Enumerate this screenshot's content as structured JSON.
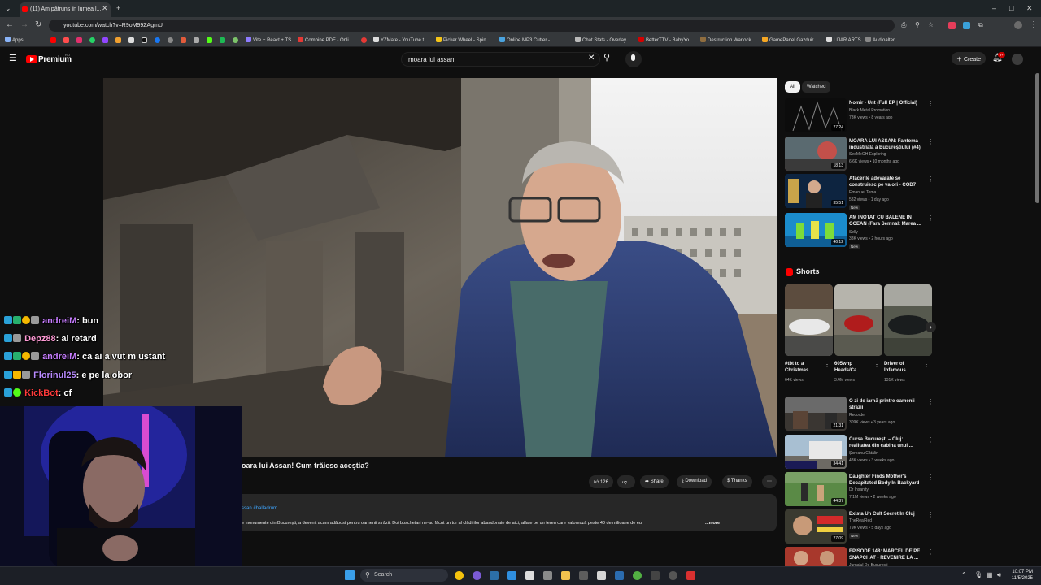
{
  "browser": {
    "tab_title": "(11) Am pătruns în lumea l...",
    "url": "youtube.com/watch?v=R9oM99ZAgmU",
    "bookmarks": [
      "Apps",
      "Vite + React + TS",
      "Combine PDF - Onli...",
      "YZMate - YouTube t...",
      "Picker Wheel - Spin...",
      "Online MP3 Cutter -...",
      "Chat Stats - Overlay...",
      "BetterTTV - BabyYo...",
      "Destruction Warlock...",
      "GamePanel Gazduir...",
      "LIJAR ARTS",
      "Audioalter"
    ]
  },
  "youtube": {
    "logo_text": "Premium",
    "logo_sup": "RO",
    "search_value": "moara lui assan",
    "create_label": "Create",
    "notif_count": "9+",
    "video_title": "oara lui Assan! Cum trăiesc aceștia?",
    "likes": "126",
    "share_label": "Share",
    "download_label": "Download",
    "thanks_label": "Thanks",
    "desc_tags": "ssan #halladrum",
    "desc_text": "e monumente din București, a devenit acum adăpost pentru oamenii străzii. Doi boschetari ne-au făcut un tur al clădirilor abandonate de aici, aflate pe un teren care valorează peste 40 de milioane de eur",
    "desc_more": "...more",
    "chips": [
      "All",
      "Watched"
    ],
    "recommendations": [
      {
        "title": "Nomir - Unt (Full EP | Official)",
        "channel": "Black Metal Promotion",
        "meta": "73K views • 8 years ago",
        "duration": "27:24",
        "badge": ""
      },
      {
        "title": "MOARA LUI ASSAN: Fantoma industrială a Bucureștiului (#4)",
        "channel": "SeeMeOH Exploring",
        "meta": "6.6K views • 10 months ago",
        "duration": "18:13",
        "badge": ""
      },
      {
        "title": "Afacerile adevărate se construiesc pe valori - COD7",
        "channel": "Emanuel Toma",
        "meta": "582 views • 1 day ago",
        "duration": "35:51",
        "badge": "New"
      },
      {
        "title": "AM INOTAT CU BALENE IN OCEAN (Fara Semnal: Marea ...",
        "channel": "Selly",
        "meta": "38K views • 2 hours ago",
        "duration": "46:12",
        "badge": "New"
      },
      {
        "title": "O zi de iarnă printre oamenii străzii",
        "channel": "Recorder",
        "meta": "309K views • 3 years ago",
        "duration": "21:31",
        "badge": ""
      },
      {
        "title": "Cursa București – Cluj: realitatea din cabina unui ...",
        "channel": "Șoreanu Cătălin",
        "meta": "48K views • 3 weeks ago",
        "duration": "34:41",
        "badge": ""
      },
      {
        "title": "Daughter Finds Mother's Decapitated Body In Backyard",
        "channel": "Dr Insanity",
        "meta": "7.1M views • 2 weeks ago",
        "duration": "44:37",
        "badge": ""
      },
      {
        "title": "Exista Un Cult Secret In Cluj",
        "channel": "TheRealRed",
        "meta": "79K views • 5 days ago",
        "duration": "27:09",
        "badge": "New"
      },
      {
        "title": "EPISODE 148: MARCEL DE PE SNAPCHAT - REVENIRE LA ...",
        "channel": "Jurnalul De Bucuresti",
        "meta": "",
        "duration": "",
        "badge": ""
      }
    ],
    "shorts_label": "Shorts",
    "shorts": [
      {
        "title": "#tbt to a Christmas ...",
        "views": "64K views"
      },
      {
        "title": "605whp Heads/Ca...",
        "views": "3.4M views"
      },
      {
        "title": "Driver of Infamous ...",
        "views": "131K views"
      }
    ]
  },
  "chat": [
    {
      "user": "andreiM",
      "msg": "bun",
      "color": "#c77dff"
    },
    {
      "user": "Depz88",
      "msg": "ai retard",
      "color": "#ff9ad5"
    },
    {
      "user": "andreiM",
      "msg": "ca ai a vut m ustant",
      "color": "#c77dff"
    },
    {
      "user": "Florinul25",
      "msg": "e pe la obor",
      "color": "#b98bff"
    },
    {
      "user": "KickBot",
      "msg": "cf",
      "color": "#ff3b3b"
    }
  ],
  "taskbar": {
    "search_placeholder": "Search",
    "time": "10:07 PM",
    "date": "11/5/2025"
  }
}
